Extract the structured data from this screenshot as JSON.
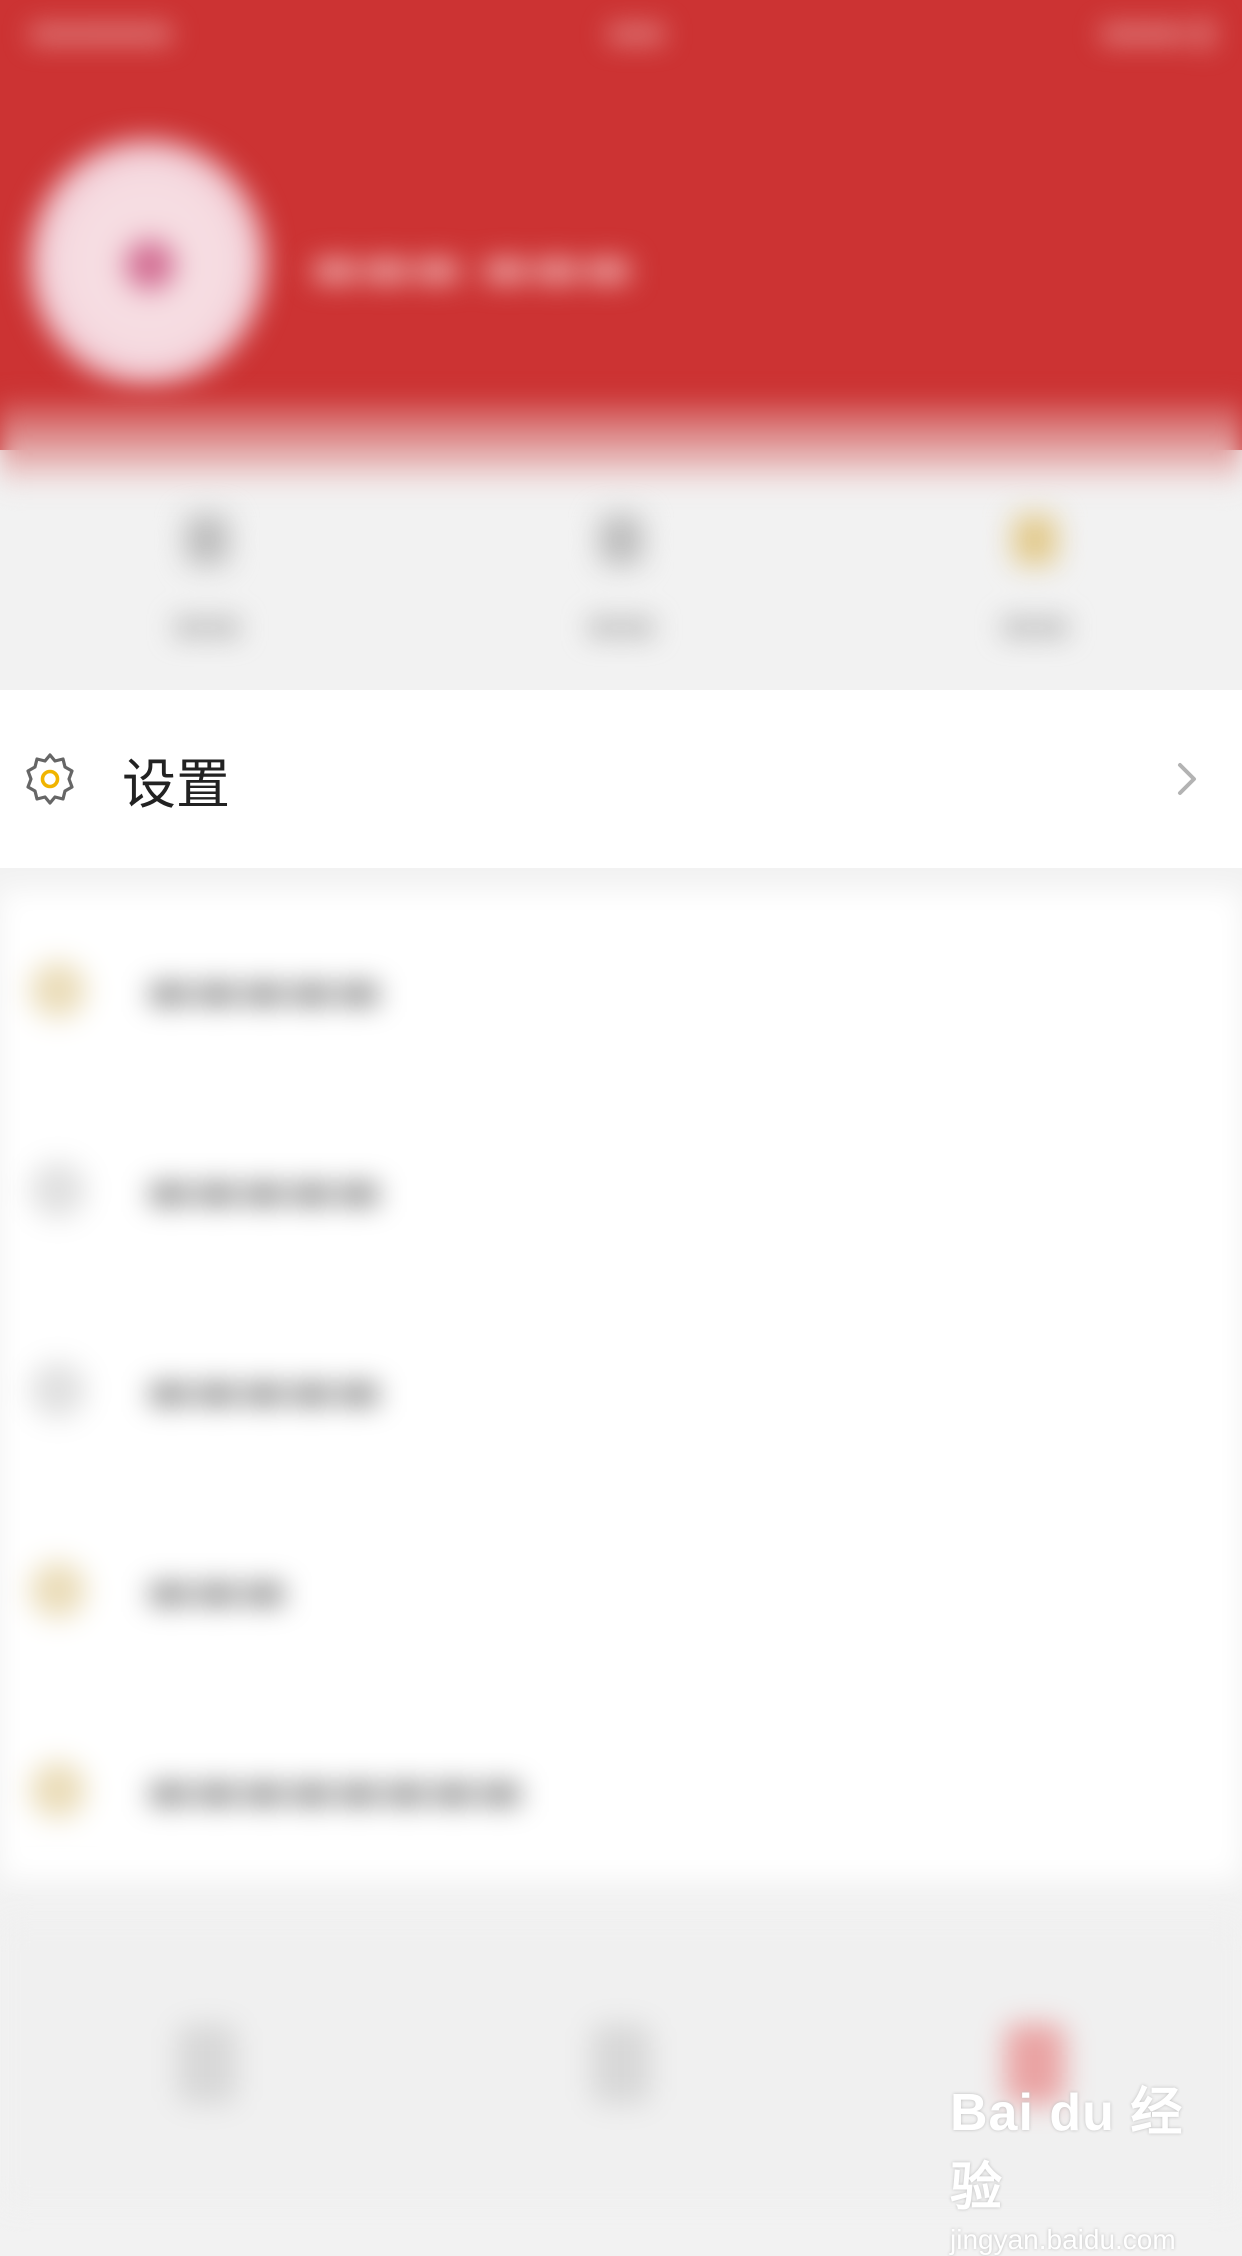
{
  "settings": {
    "label": "设置"
  },
  "watermark": {
    "brand": "Bai du 经验",
    "url": "jingyan.baidu.com"
  },
  "colors": {
    "header": "#cc3333",
    "gear_accent": "#f0b400",
    "icon_gray": "#666666",
    "chevron": "#b3b3b3"
  }
}
